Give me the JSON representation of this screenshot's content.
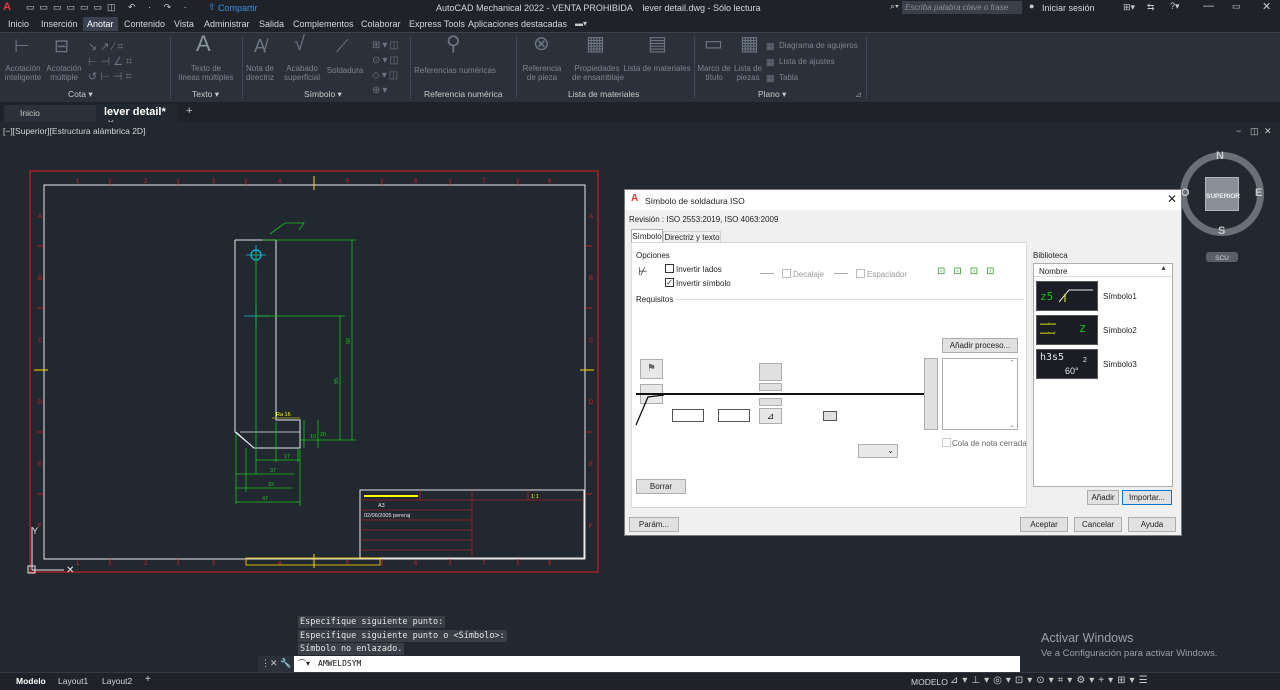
{
  "titlebar": {
    "title": "AutoCAD Mechanical 2022 - VENTA PROHIBIDA    lever detail.dwg - Sólo lectura",
    "share": "Compartir",
    "search_placeholder": "Escriba palabra clave o frase",
    "login": "Iniciar sesión"
  },
  "menu": {
    "items": [
      "Inicio",
      "Inserción",
      "Anotar",
      "Contenido",
      "Vista",
      "Administrar",
      "Salida",
      "Complementos",
      "Colaborar",
      "Express Tools",
      "Aplicaciones destacadas"
    ],
    "active": "Anotar"
  },
  "ribbon": {
    "tools": [
      "Acotación\ninteligente",
      "Acotación\nmúltiple",
      "Texto de\nlíneas múltiples",
      "Nota de\ndirectriz",
      "Acabado\nsuperficial",
      "Soldadura",
      "Referencias numéricas",
      "Referencia\nde pieza",
      "Propiedades\nde ensamblaje",
      "Lista de materiales",
      "Marco de\ntítulo",
      "Lista de\npiezas"
    ],
    "small_tools": [
      "Diagrama de agujeros",
      "Lista de ajustes",
      "Tabla"
    ],
    "panels": [
      "Cota",
      "Texto",
      "Símbolo",
      "Referencia numérica",
      "Lista de materiales",
      "Plano"
    ]
  },
  "filetabs": {
    "home": "Inicio",
    "active": "lever detail*"
  },
  "viewport": {
    "label": "[−][Superior][Estructura alámbrica 2D]"
  },
  "viewcube": {
    "n": "N",
    "s": "S",
    "e": "E",
    "o": "O",
    "face": "SUPERIOR",
    "ucs": "SCU"
  },
  "drawing": {
    "dims": [
      "50",
      "95",
      "Ra 16",
      "10",
      "17",
      "37",
      "32",
      "47",
      "20"
    ],
    "titleblock": [
      "A3",
      "02/06/2005  pereraj",
      "1:1"
    ],
    "ruler_numbers": [
      "1",
      "2",
      "3",
      "4",
      "5",
      "6",
      "7",
      "8"
    ],
    "ruler_letters": [
      "A",
      "B",
      "C",
      "D",
      "E",
      "F"
    ]
  },
  "dialog": {
    "title": "Símbolo de soldadura ISO",
    "revision": "Revisión : ISO 2553:2019, ISO 4063:2009",
    "tabs": [
      "Símbolo",
      "Directriz y texto"
    ],
    "opciones": "Opciones",
    "invertir_lados": "Invertir lados",
    "invertir_simbolo": "Invertir símbolo",
    "decalaje": "Decalaje",
    "espaciador": "Espaciador",
    "requisitos": "Requisitos",
    "anadir_proceso": "Añadir proceso...",
    "cola": "Cola de nota cerrada",
    "borrar": "Borrar",
    "param": "Parám...",
    "aceptar": "Aceptar",
    "cancelar": "Cancelar",
    "ayuda": "Ayuda",
    "biblioteca": "Biblioteca",
    "nombre": "Nombre",
    "anadir": "Añadir",
    "importar": "Importar...",
    "library": [
      {
        "name": "Símbolo1",
        "preview": "z5"
      },
      {
        "name": "Símbolo2",
        "preview": "z"
      },
      {
        "name": "Símbolo3",
        "preview": "h3s5",
        "sub": "60°",
        "digit": "2"
      }
    ]
  },
  "command": {
    "history": [
      "Especifique siguiente punto:",
      "Especifique siguiente punto o <Símbolo>:",
      "Símbolo no enlazado."
    ],
    "input": "AMWELDSYM"
  },
  "watermark": {
    "title": "Activar Windows",
    "subtitle": "Ve a Configuración para activar Windows."
  },
  "status": {
    "tabs": [
      "Modelo",
      "Layout1",
      "Layout2"
    ],
    "mode": "MODELO"
  },
  "colors": {
    "accent": "#0078d7",
    "drawing_red": "#e02020",
    "drawing_green": "#19c219",
    "drawing_yellow": "#ffff00",
    "dialog_bg": "#f0f0f0"
  }
}
